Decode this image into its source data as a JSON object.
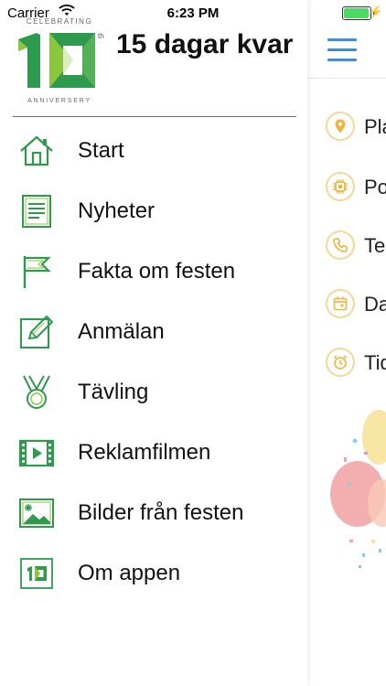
{
  "status_bar": {
    "carrier": "Carrier",
    "time": "6:23 PM",
    "battery_level": 0.95
  },
  "logo": {
    "top_text": "CELEBRATING",
    "numeral": "10",
    "superscript": "th",
    "bottom_text": "ANNIVERSERY"
  },
  "countdown": "15 dagar kvar",
  "menu": {
    "items": [
      {
        "label": "Start",
        "icon": "home-icon"
      },
      {
        "label": "Nyheter",
        "icon": "news-icon"
      },
      {
        "label": "Fakta om festen",
        "icon": "flag-icon"
      },
      {
        "label": "Anmälan",
        "icon": "edit-icon"
      },
      {
        "label": "Tävling",
        "icon": "medal-icon"
      },
      {
        "label": "Reklamfilmen",
        "icon": "film-icon"
      },
      {
        "label": "Bilder från festen",
        "icon": "photo-icon"
      },
      {
        "label": "Om appen",
        "icon": "app-logo-icon"
      }
    ]
  },
  "main": {
    "info_rows": [
      {
        "text": "Pla",
        "icon": "location-pin-icon"
      },
      {
        "text": "Po",
        "icon": "chip-icon"
      },
      {
        "text": "Te",
        "icon": "phone-icon"
      },
      {
        "text": "Da",
        "icon": "calendar-icon"
      },
      {
        "text": "Tid",
        "icon": "alarm-clock-icon"
      }
    ]
  },
  "colors": {
    "brand_green": "#2e9a4e",
    "logo_green": "#8cc63f",
    "accent_blue": "#3b8fd8",
    "info_icon_orange": "#f0b43c"
  }
}
